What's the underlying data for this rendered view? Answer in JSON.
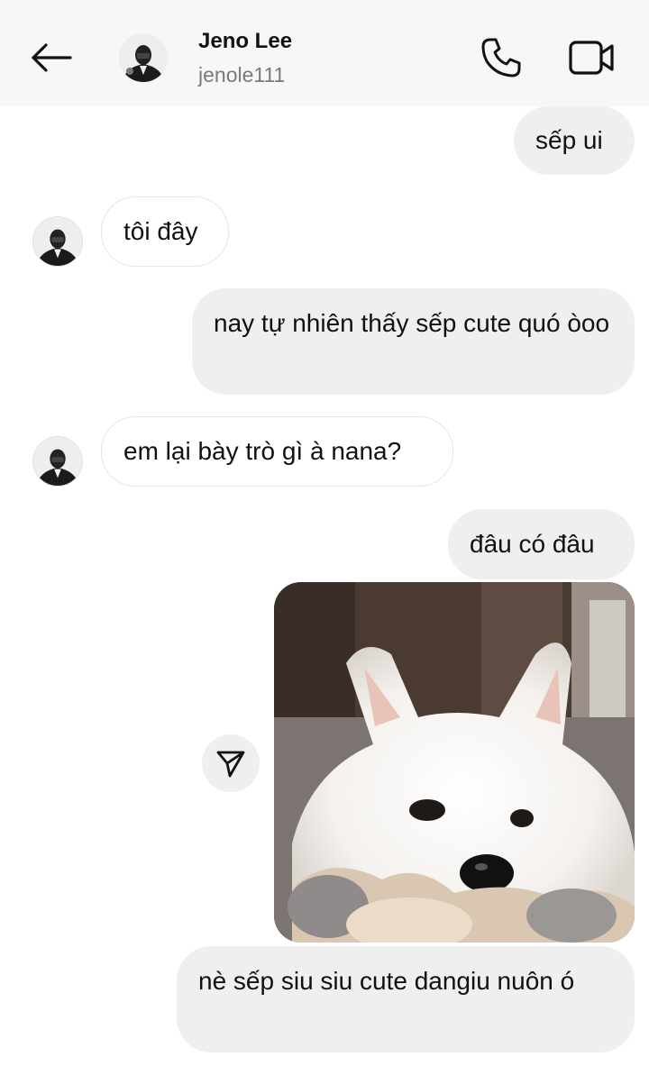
{
  "header": {
    "name": "Jeno Lee",
    "username": "jenole111",
    "icons": {
      "back": "arrow-left-icon",
      "call": "phone-icon",
      "video": "video-camera-icon"
    }
  },
  "messages": [
    {
      "from": "me",
      "text": "sếp ui"
    },
    {
      "from": "them",
      "text": "tôi đây"
    },
    {
      "from": "me",
      "text": "nay tự nhiên thấy sếp cute quó òoo"
    },
    {
      "from": "them",
      "text": "em lại bày trò gì à nana?"
    },
    {
      "from": "me",
      "text": "đâu có đâu"
    },
    {
      "from": "me",
      "type": "image",
      "subject": "fluffy white samoyed puppy"
    },
    {
      "from": "me",
      "text": "nè sếp siu siu cute dangiu nuôn ó"
    }
  ],
  "icons": {
    "share": "send-icon"
  },
  "colors": {
    "outgoing_bubble": "#efefef",
    "incoming_border": "#e6e6e6",
    "header_bg": "#f7f7f7",
    "secondary_text": "#7a7a7a"
  }
}
